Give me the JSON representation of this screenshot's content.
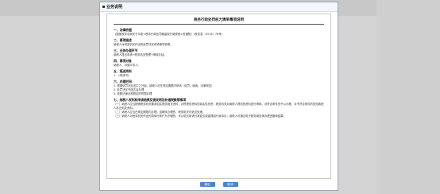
{
  "dialog": {
    "title": "业务说明",
    "buttons": {
      "confirm": "确定",
      "cancel": "取消"
    }
  },
  "document": {
    "title": "税务行政处罚权力清单事项说明",
    "sections": [
      {
        "heading": "一、法律依据",
        "lines": [
          "《国家税务总局关于印发<税务行政处罚裁量权行使规则>的通知》（税总发〔2016〕78号）"
        ]
      },
      {
        "heading": "二、事项描述",
        "lines": [
          "纳税人对税务机关作出的处罚决定申请事项说明。"
        ]
      },
      {
        "heading": "三、业务办理环节",
        "lines": [
          "纳税人提出申请→税务机关受理→审核办结。"
        ]
      },
      {
        "heading": "四、事项对象",
        "lines": [
          "纳税人、扣缴义务人。"
        ]
      },
      {
        "heading": "五、报送资料",
        "lines": [
          "1. 《申请书》"
        ]
      },
      {
        "heading": "六、办理时间",
        "lines": [
          "1. 根据处罚决定送达之日起，纳税人可在规定期限内申请（处罚、缴纳、法律规定）",
          "2. 处罚决定书送达后办理",
          "3. 依照法律法规规定的时限办理"
        ]
      },
      {
        "heading": "七、纳税人权利和申请结果反馈说明及补缴税款等事项",
        "paragraphs": [
          "（一）纳税人应当按照税务机关要求如实提供相关资料，对所提供资料的真实性负责；税务机关对纳税人提供的资料进行审核，对符合条件的予以办理，对不符合条件的告知纳税人补正相关资料。",
          "（二）纳税人应当在规定期限内办理，逾期未办理的，税务机关可依法处理。",
          "（三）纳税人对税务机关作出的具体行政行为不服的，可以依法申请行政复议或者提起行政诉讼；纳税人可通过电子税务局查询办理进度和结果。"
        ]
      }
    ]
  }
}
